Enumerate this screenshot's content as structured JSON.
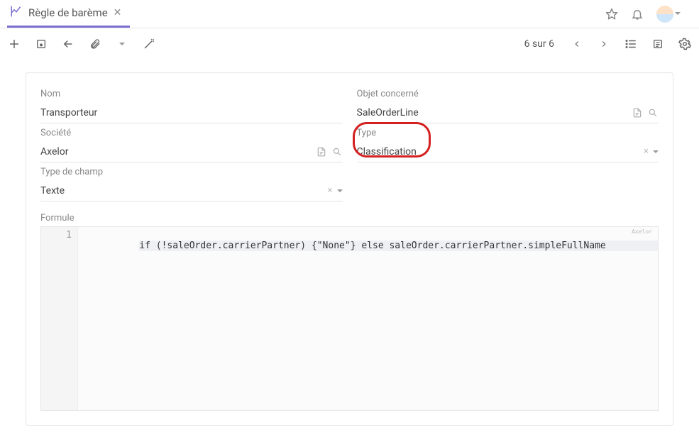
{
  "tab": {
    "title": "Règle de barème"
  },
  "toolbar": {
    "pager": "6 sur 6"
  },
  "fields": {
    "nom": {
      "label": "Nom",
      "value": "Transporteur"
    },
    "objet": {
      "label": "Objet concerné",
      "value": "SaleOrderLine"
    },
    "societe": {
      "label": "Société",
      "value": "Axelor"
    },
    "type": {
      "label": "Type",
      "value": "Classification"
    },
    "typeChamp": {
      "label": "Type de champ",
      "value": "Texte"
    },
    "formule": {
      "label": "Formule",
      "lineNo": "1",
      "code": "if (!saleOrder.carrierPartner) {\"None\"} else saleOrder.carrierPartner.simpleFullName"
    }
  },
  "watermark": "Axelor"
}
